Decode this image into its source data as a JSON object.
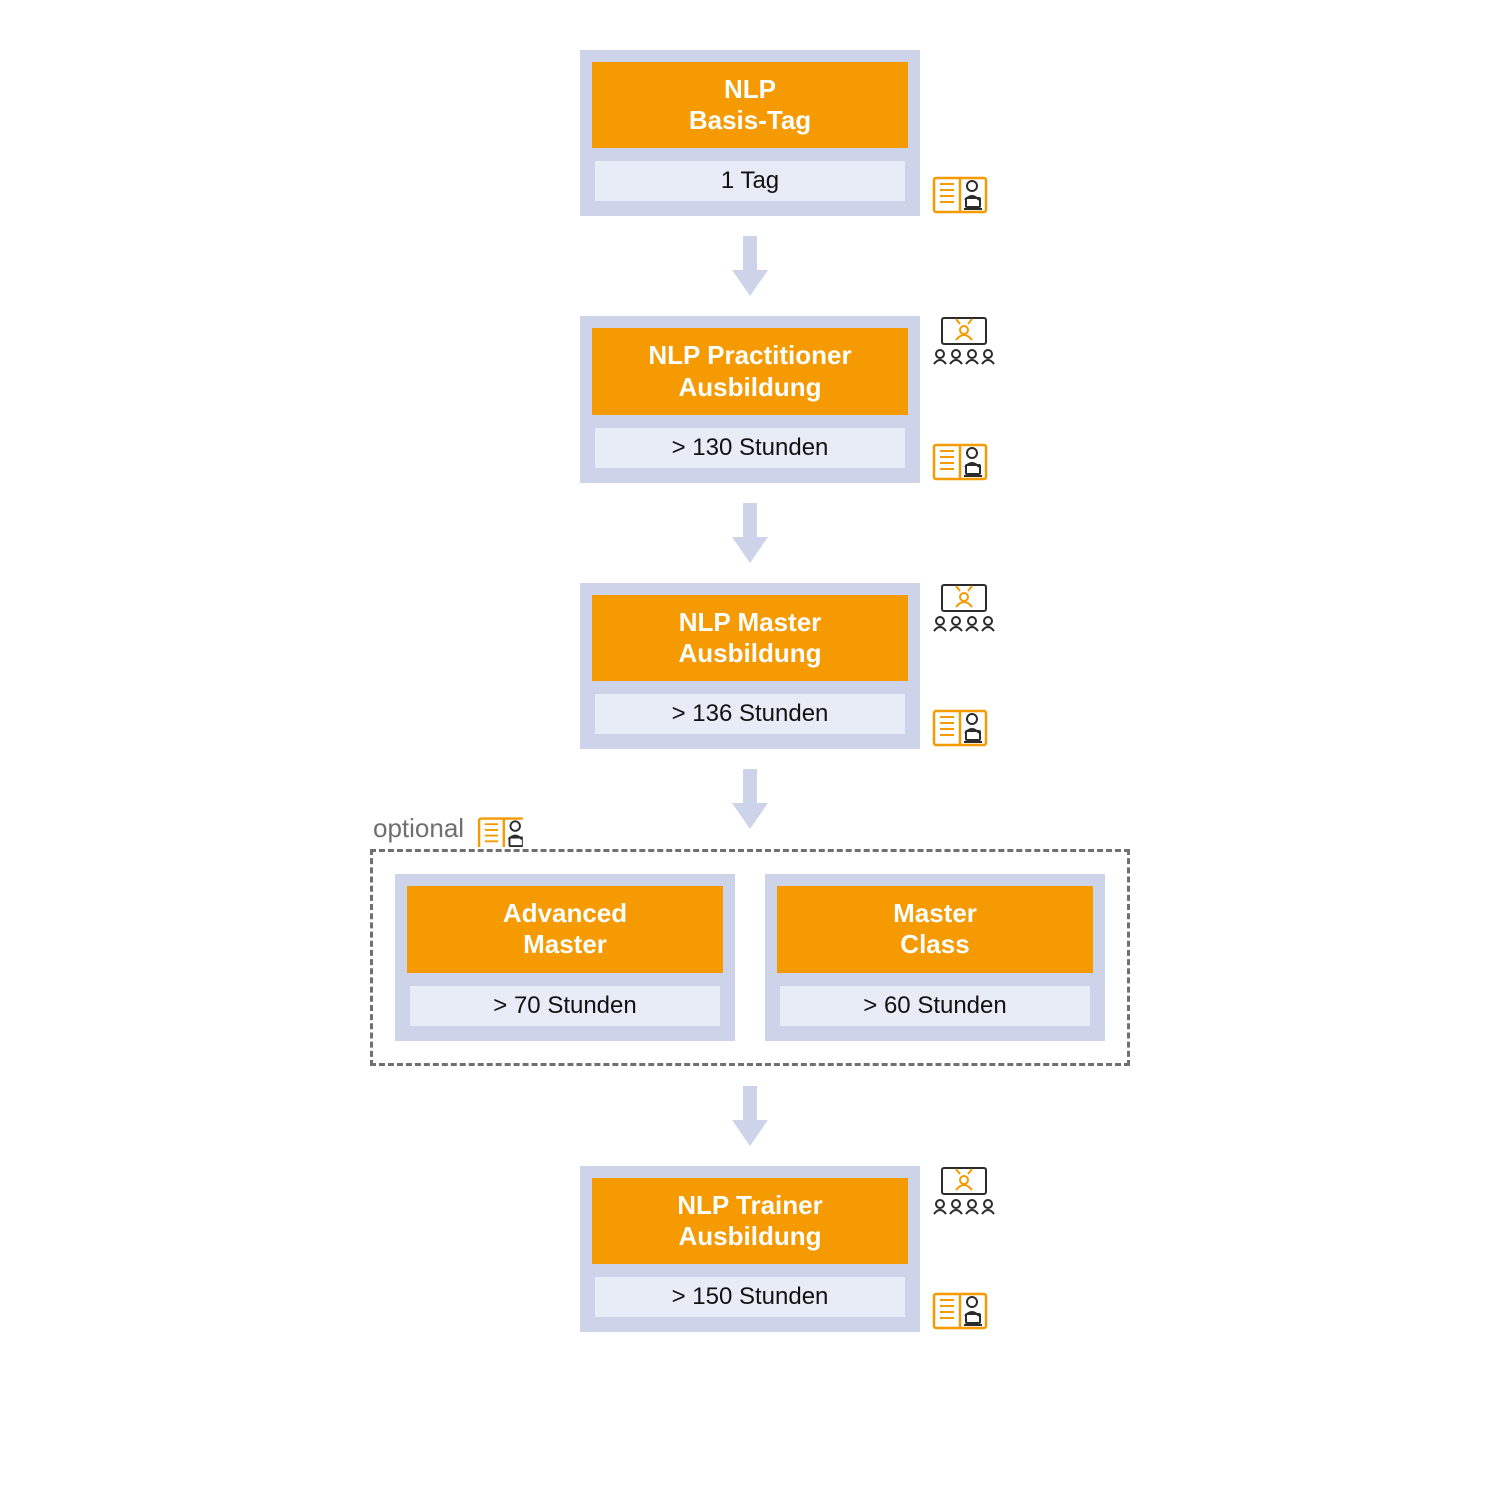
{
  "colors": {
    "accent": "#f59a00",
    "frame": "#cdd4ea",
    "text_inverse": "#ffffff",
    "optional_border": "#707070"
  },
  "optional_label": "optional",
  "steps": [
    {
      "title": "NLP\nBasis-Tag",
      "duration": "1 Tag",
      "icons": [
        "book"
      ]
    },
    {
      "title": "NLP Practitioner\nAusbildung",
      "duration": "> 130 Stunden",
      "icons": [
        "class",
        "book"
      ]
    },
    {
      "title": "NLP Master\nAusbildung",
      "duration": "> 136 Stunden",
      "icons": [
        "class",
        "book"
      ]
    }
  ],
  "optional_group": [
    {
      "title": "Advanced\nMaster",
      "duration": "> 70 Stunden"
    },
    {
      "title": "Master\nClass",
      "duration": "> 60 Stunden"
    }
  ],
  "final_step": {
    "title": "NLP Trainer\nAusbildung",
    "duration": "> 150 Stunden",
    "icons": [
      "class",
      "book"
    ]
  }
}
